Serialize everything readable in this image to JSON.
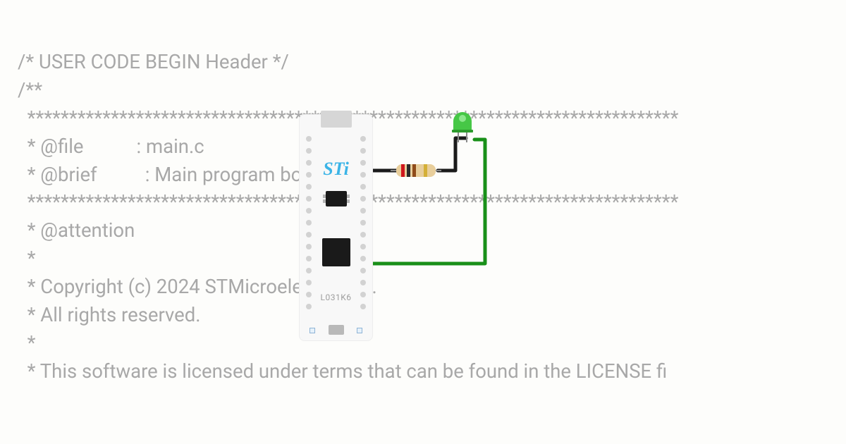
{
  "code": {
    "lines": [
      "/* USER CODE BEGIN Header */",
      "/**",
      "  ******************************************************************************",
      "  * @file           : main.c",
      "  * @brief          : Main program body",
      "  ******************************************************************************",
      "  * @attention",
      "  *",
      "  * Copyright (c) 2024 STMicroelectronics.",
      "  * All rights reserved.",
      "  *",
      "  * This software is licensed under terms that can be found in the LICENSE fi"
    ]
  },
  "board": {
    "logo": "STi",
    "label": "L031K6",
    "pins_per_side": 15
  },
  "components": {
    "resistor_bands": [
      "red",
      "black",
      "brown",
      "gold"
    ],
    "led_color": "#36b336"
  },
  "colors": {
    "wire_black": "#1b1b1b",
    "wire_green": "#199019",
    "code_text": "#a8a8a8",
    "st_blue": "#3bb4e7"
  }
}
